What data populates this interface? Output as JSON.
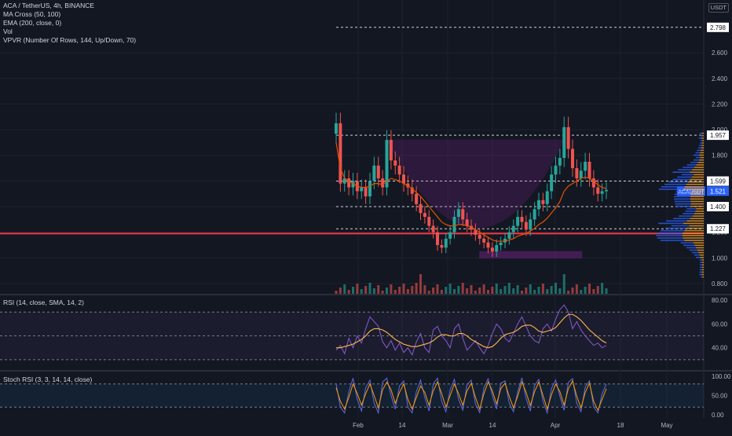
{
  "legend": {
    "title": "ACA / TetherUS, 4h, BINANCE",
    "items": [
      "MA Cross (50, 100)",
      "EMA (200, close, 0)",
      "Vol",
      "VPVR (Number Of Rows, 144, Up/Down, 70)"
    ]
  },
  "currency": "USDT",
  "colors": {
    "background": "#131722",
    "grid": "#1e222d",
    "up": "#26a69a",
    "down": "#ef5350",
    "ema200": "#e65100",
    "ma_fast": "#2962ff",
    "vpvr_up": "#2962ff",
    "vpvr_down": "#ffa726",
    "rsi": "#7e57c2",
    "rsi_sma": "#ffb74d",
    "stoch_k": "#5b6be8",
    "stoch_d": "#ff9800",
    "horizontal_support": "#f23645",
    "dashed_levels": "#ffffff",
    "cup": "#9c27b0"
  },
  "chart_data": [
    {
      "type": "candlestick",
      "pane": "price",
      "y_ticks": [
        "2.600",
        "2.400",
        "2.200",
        "2.000",
        "1.800",
        "1.600",
        "1.400",
        "1.200",
        "1.000",
        "0.800"
      ],
      "ylim": [
        0.72,
        2.95
      ],
      "x_ticks": [
        "Feb",
        "14",
        "Mar",
        "14",
        "Apr",
        "18",
        "May"
      ],
      "price_labels": [
        {
          "value": 2.798,
          "label": "2.798"
        },
        {
          "value": 1.957,
          "label": "1.957"
        },
        {
          "value": 1.599,
          "label": "1.599"
        },
        {
          "value": 1.521,
          "label": "1.521",
          "symbol": "ACAUSDT"
        },
        {
          "value": 1.4,
          "label": "1.400"
        },
        {
          "value": 1.227,
          "label": "1.227"
        }
      ],
      "horizontal_line": 1.19,
      "series": [
        {
          "name": "ACA/USDT close",
          "values": [
            2.05,
            1.58,
            1.62,
            1.55,
            1.6,
            1.52,
            1.55,
            1.48,
            1.6,
            1.72,
            1.62,
            1.55,
            1.92,
            1.76,
            1.72,
            1.65,
            1.58,
            1.55,
            1.5,
            1.42,
            1.35,
            1.32,
            1.25,
            1.2,
            1.1,
            1.08,
            1.15,
            1.2,
            1.32,
            1.38,
            1.3,
            1.25,
            1.22,
            1.18,
            1.15,
            1.12,
            1.08,
            1.05,
            1.1,
            1.12,
            1.15,
            1.2,
            1.25,
            1.32,
            1.28,
            1.22,
            1.3,
            1.38,
            1.45,
            1.42,
            1.52,
            1.65,
            1.72,
            1.78,
            2.02,
            1.85,
            1.7,
            1.62,
            1.68,
            1.75,
            1.62,
            1.55,
            1.5,
            1.52,
            1.53
          ]
        },
        {
          "name": "EMA (200)",
          "values": [
            1.9,
            1.7,
            1.62,
            1.6,
            1.58,
            1.56,
            1.55,
            1.55,
            1.56,
            1.58,
            1.58,
            1.57,
            1.6,
            1.62,
            1.61,
            1.6,
            1.58,
            1.56,
            1.54,
            1.51,
            1.48,
            1.44,
            1.4,
            1.36,
            1.32,
            1.28,
            1.26,
            1.25,
            1.25,
            1.26,
            1.26,
            1.25,
            1.24,
            1.22,
            1.2,
            1.18,
            1.16,
            1.14,
            1.13,
            1.13,
            1.13,
            1.14,
            1.15,
            1.17,
            1.18,
            1.19,
            1.21,
            1.23,
            1.26,
            1.28,
            1.31,
            1.35,
            1.39,
            1.44,
            1.52,
            1.56,
            1.58,
            1.6,
            1.62,
            1.63,
            1.62,
            1.6,
            1.57,
            1.55,
            1.54
          ]
        }
      ]
    },
    {
      "type": "line",
      "pane": "rsi",
      "title": "RSI (14, close, SMA, 14, 2)",
      "y_ticks": [
        "80.00",
        "60.00",
        "40.00"
      ],
      "ylim": [
        22,
        84
      ],
      "bands": [
        70,
        50,
        30
      ],
      "series": [
        {
          "name": "RSI",
          "values": [
            38,
            42,
            35,
            48,
            40,
            50,
            44,
            56,
            66,
            62,
            58,
            45,
            40,
            46,
            38,
            44,
            36,
            40,
            34,
            45,
            52,
            40,
            36,
            55,
            58,
            50,
            46,
            40,
            56,
            60,
            48,
            38,
            42,
            46,
            40,
            35,
            42,
            52,
            60,
            56,
            48,
            45,
            52,
            60,
            66,
            58,
            50,
            46,
            44,
            56,
            60,
            54,
            64,
            72,
            76,
            70,
            56,
            62,
            55,
            50,
            46,
            42,
            44,
            40,
            42
          ]
        },
        {
          "name": "RSI SMA",
          "values": [
            40,
            40,
            41,
            42,
            43,
            45,
            47,
            50,
            54,
            56,
            56,
            55,
            53,
            50,
            47,
            45,
            43,
            42,
            41,
            41,
            42,
            43,
            44,
            46,
            49,
            51,
            51,
            50,
            50,
            52,
            52,
            50,
            47,
            45,
            43,
            41,
            40,
            41,
            44,
            48,
            51,
            52,
            53,
            55,
            58,
            59,
            59,
            57,
            54,
            53,
            54,
            55,
            57,
            61,
            65,
            68,
            68,
            66,
            63,
            59,
            55,
            52,
            49,
            46,
            44
          ]
        }
      ]
    },
    {
      "type": "line",
      "pane": "stoch_rsi",
      "title": "Stoch RSI (3, 3, 14, 14, close)",
      "y_ticks": [
        "100.00",
        "50.00",
        "0.00"
      ],
      "ylim": [
        -8,
        110
      ],
      "bands": [
        80,
        20
      ],
      "series": [
        {
          "name": "K",
          "values": [
            80,
            20,
            5,
            60,
            95,
            40,
            10,
            70,
            90,
            30,
            5,
            85,
            95,
            50,
            15,
            75,
            88,
            20,
            5,
            60,
            90,
            45,
            10,
            80,
            95,
            35,
            8,
            65,
            92,
            40,
            12,
            78,
            90,
            28,
            6,
            70,
            94,
            50,
            15,
            82,
            88,
            30,
            8,
            60,
            96,
            42,
            10,
            76,
            92,
            35,
            5,
            68,
            90,
            48,
            12,
            84,
            94,
            30,
            8,
            72,
            88,
            20,
            5,
            55,
            80
          ]
        },
        {
          "name": "D",
          "values": [
            70,
            35,
            15,
            45,
            80,
            55,
            25,
            55,
            80,
            50,
            18,
            65,
            85,
            65,
            30,
            58,
            80,
            40,
            15,
            45,
            75,
            58,
            25,
            62,
            85,
            55,
            20,
            50,
            80,
            55,
            25,
            62,
            82,
            45,
            15,
            55,
            85,
            62,
            28,
            68,
            82,
            48,
            18,
            48,
            85,
            58,
            24,
            60,
            85,
            50,
            15,
            52,
            80,
            60,
            25,
            68,
            88,
            48,
            18,
            58,
            82,
            35,
            12,
            40,
            68
          ]
        }
      ]
    }
  ]
}
